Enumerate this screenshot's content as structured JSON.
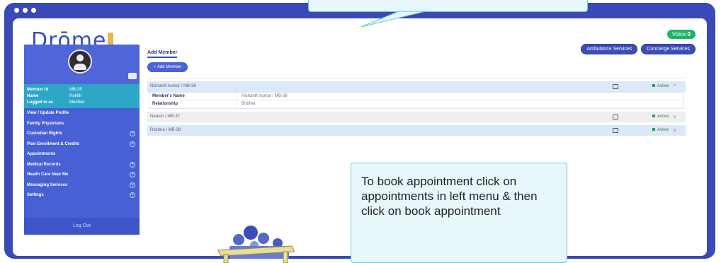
{
  "app": {
    "logo_text": "Drōme",
    "voice_label": "Voice",
    "voice_count": "0"
  },
  "header": {
    "ambulance_label": "Ambulance Services",
    "concierge_label": "Concierge Services"
  },
  "sidebar": {
    "member_info": [
      {
        "key": "Member Id",
        "value": "MB-35"
      },
      {
        "key": "Name",
        "value": "Rohith"
      },
      {
        "key": "Logged in as",
        "value": "Member"
      }
    ],
    "items": [
      {
        "label": "View / Update Profile",
        "expandable": false
      },
      {
        "label": "Family Physicians",
        "expandable": false
      },
      {
        "label": "Custodian Rights",
        "expandable": true
      },
      {
        "label": "Plan Enrollment & Credits",
        "expandable": true
      },
      {
        "label": "Appointments",
        "expandable": false
      },
      {
        "label": "Medical Records",
        "expandable": true
      },
      {
        "label": "Health Care Near Me",
        "expandable": true
      },
      {
        "label": "Messaging Services",
        "expandable": true
      },
      {
        "label": "Settings",
        "expandable": true
      }
    ],
    "logout_label": "Log Out"
  },
  "main": {
    "tab_title": "Add Member",
    "add_button": "+ Add Member",
    "members": [
      {
        "title": "Nishanth kumar / MB-36",
        "status": "Active",
        "chevron": "^",
        "expanded": true,
        "details": [
          {
            "k": "Member's Name",
            "v": "Nishanth kumar / MB-36"
          },
          {
            "k": "Relationship",
            "v": "Brother"
          }
        ]
      },
      {
        "title": "Naresh / MB-37",
        "status": "Active",
        "chevron": "v",
        "expanded": false
      },
      {
        "title": "Roshna / MB-38",
        "status": "Active",
        "chevron": "v",
        "expanded": false
      }
    ]
  },
  "tooltip": {
    "text": "To book appointment click on appointments in left menu & then click on book appointment"
  },
  "colors": {
    "frame": "#3a49b5",
    "sidebar": "#4760d3",
    "member_info": "#2ea7c6",
    "accent": "#3c4db4",
    "active": "#1fa64a"
  }
}
